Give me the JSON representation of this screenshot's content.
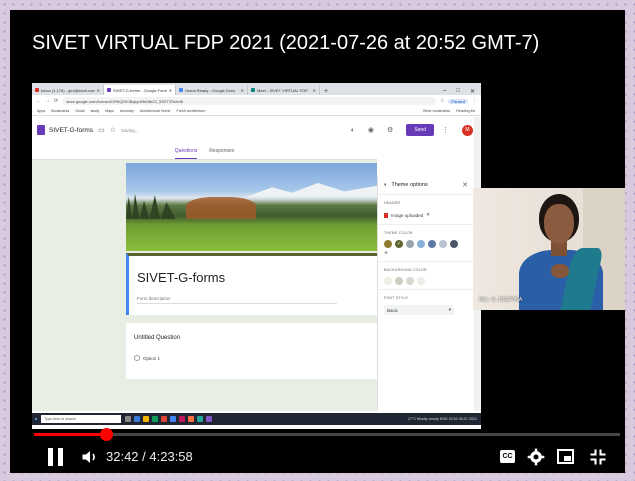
{
  "video": {
    "title": "SIVET VIRTUAL FDP 2021 (2021-07-26 at 20:52 GMT-7)",
    "current_time": "32:42",
    "duration": "4:23:58",
    "time_separator": " / ",
    "progress_fraction": 0.124,
    "buffered_fraction": 0.13,
    "accent_color": "#ff0000"
  },
  "controls": {
    "cc_label": "CC",
    "icons": [
      "pause-icon",
      "volume-icon",
      "closed-captions-icon",
      "settings-gear-icon",
      "miniplayer-icon",
      "fullscreen-exit-icon"
    ]
  },
  "browser": {
    "tabs": [
      {
        "label": "Inbox (1,176) - gen@sivet.com",
        "active": false
      },
      {
        "label": "SIVET-G-forms - Google Forms",
        "active": true
      },
      {
        "label": "Huma Ready - Google Docs",
        "active": false
      },
      {
        "label": "Meet - SIVET VIRTUAL FDP",
        "active": false
      }
    ],
    "new_tab": "+",
    "window_buttons": [
      "–",
      "□",
      "✕"
    ],
    "url": "docs.google.com/forms/d/1R5Q0V0Bqkyn0hK8bZ2_5S0T37k/edit",
    "paused_label": "Paused",
    "bookmarks": [
      "Apps",
      "Bookmarks",
      "Gmail",
      "study",
      "Maps",
      "Ancestry",
      "Architectural Home",
      "Fresh architecture",
      "Other bookmarks",
      "Reading list"
    ]
  },
  "forms": {
    "doc_title": "SIVET-G-forms",
    "saving": "Saving...",
    "send_label": "Send",
    "avatar_letter": "M",
    "tabs": [
      "Questions",
      "Responses"
    ],
    "form_title": "SIVET-G-forms",
    "form_description": "Form description",
    "question": "Untitled Question",
    "option": "Option 1",
    "brand_color": "#673ab7"
  },
  "theme_panel": {
    "title": "Theme options",
    "header_label": "HEADER",
    "header_value": "Image uploaded",
    "theme_color_label": "THEME COLOR",
    "theme_colors": [
      "#8d7a2e",
      "#5a632d",
      "#9aa4ad",
      "#8ab0d6",
      "#5c7aa5",
      "#b9c3d0",
      "#4a5568"
    ],
    "background_label": "BACKGROUND COLOR",
    "background_colors": [
      "#e8eee3",
      "#c9cfbf",
      "#d6d9cf",
      "#ecefe8"
    ],
    "font_label": "FONT STYLE",
    "font_value": "Basic"
  },
  "taskbar": {
    "search_placeholder": "Type here to search",
    "tray": "27°C Mostly cloudy  ENG  20:52  26-07-2021"
  },
  "webcam": {
    "name_tag": "Mrs. G. DEEPIKA"
  }
}
